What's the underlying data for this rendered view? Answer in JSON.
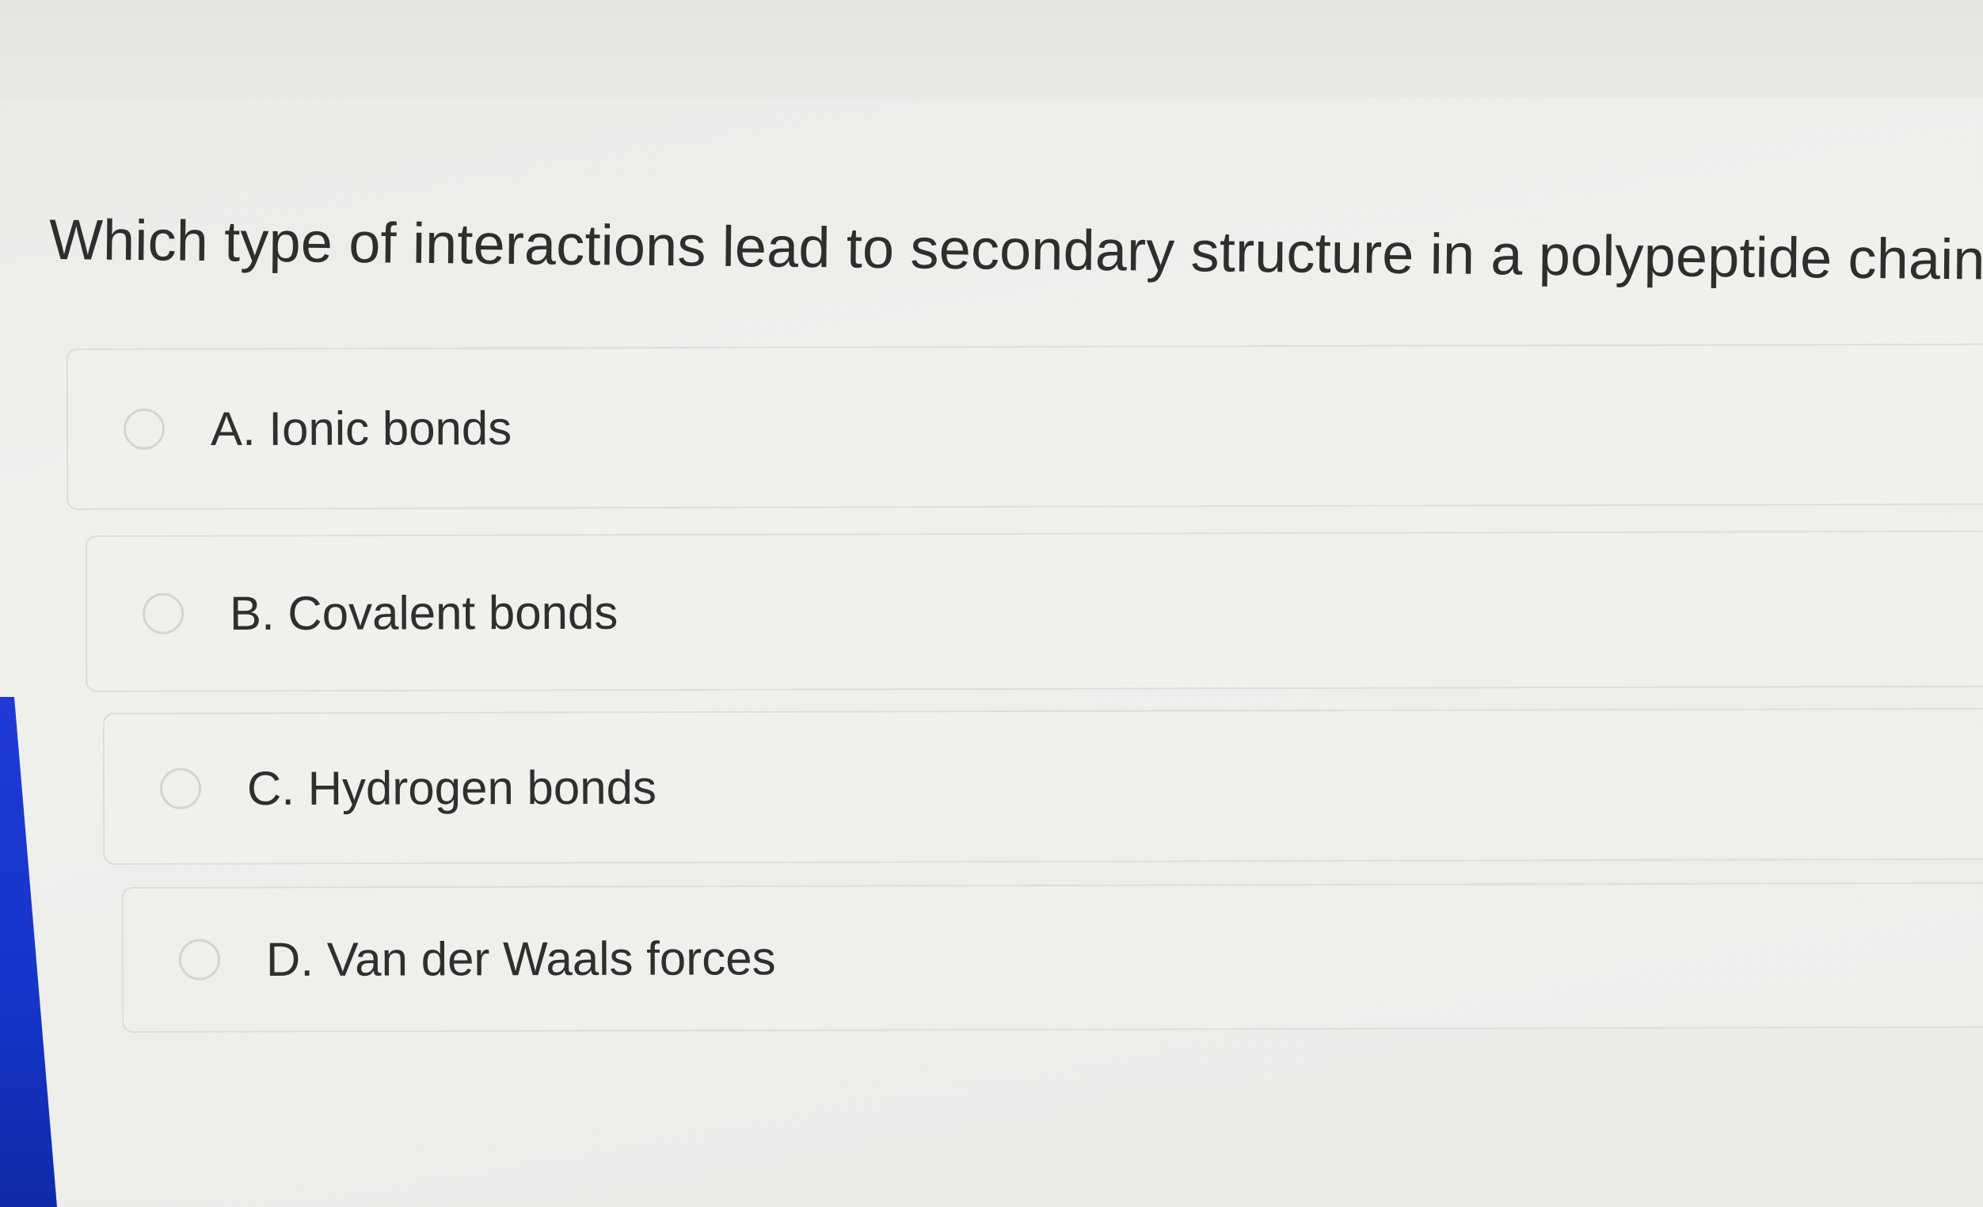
{
  "question": {
    "text": "Which type of interactions lead to secondary structure in a polypeptide chain?"
  },
  "options": [
    {
      "label": "A. Ionic bonds",
      "selected": false
    },
    {
      "label": "B. Covalent bonds",
      "selected": false
    },
    {
      "label": "C. Hydrogen bonds",
      "selected": false
    },
    {
      "label": "D. Van der Waals forces",
      "selected": false
    }
  ],
  "colors": {
    "background": "#f0f0ed",
    "text": "#2e2e2e",
    "option_border": "#dcdcd8",
    "screen_edge_blue": "#1535c9"
  }
}
